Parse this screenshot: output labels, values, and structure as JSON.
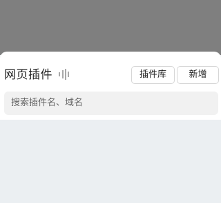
{
  "header": {
    "title": "网页插件",
    "title_icon": "voice-wave-icon"
  },
  "actions": {
    "library_label": "插件库",
    "add_label": "新增"
  },
  "search": {
    "placeholder": "搜索插件名、域名"
  },
  "colors": {
    "overlay": "#7f7f7f",
    "sheet_bg": "#ffffff",
    "body_bg": "#ebeff2",
    "search_bg": "#f1f1f1",
    "text": "#222222",
    "placeholder": "#666666"
  }
}
